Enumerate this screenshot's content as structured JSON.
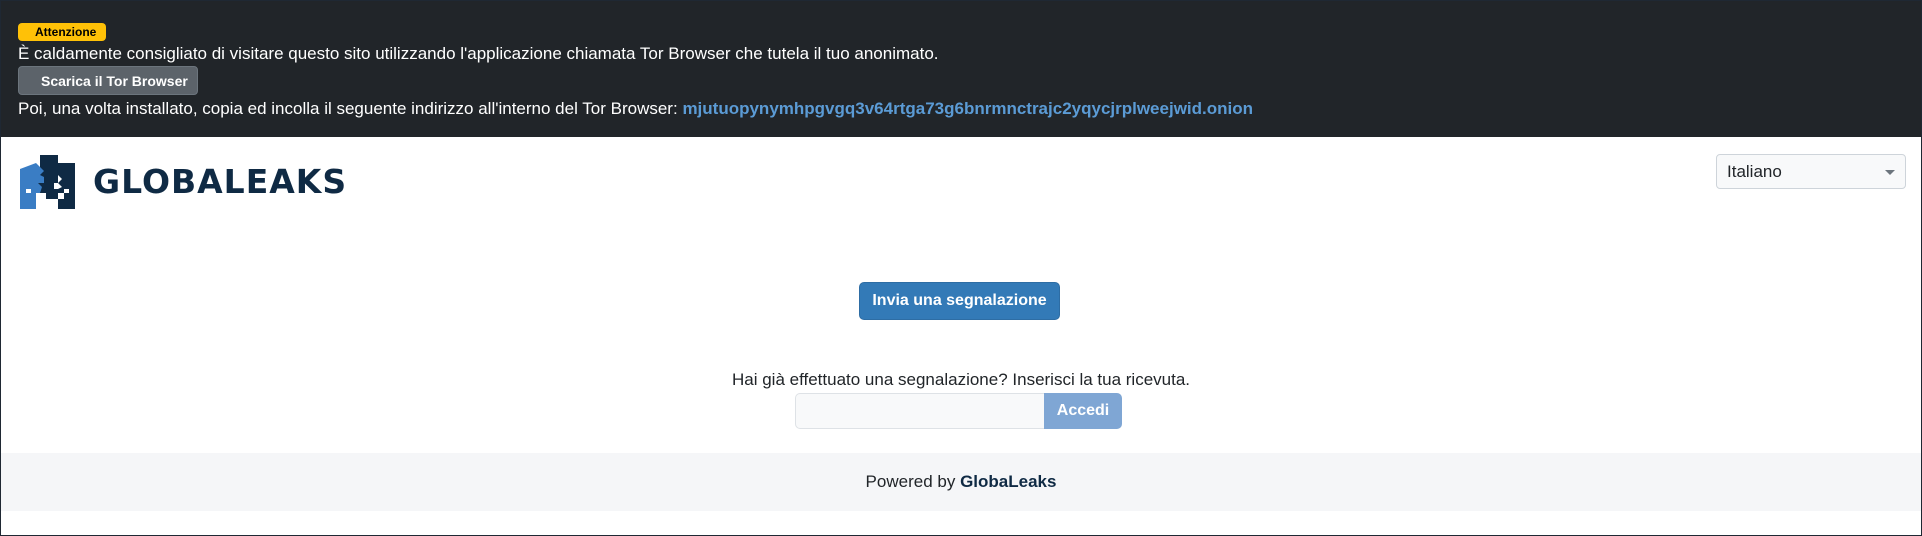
{
  "tor_banner": {
    "badge": "Attenzione",
    "message": "È caldamente consigliato di visitare questo sito utilizzando l'applicazione chiamata Tor Browser che tutela il tuo anonimato.",
    "download_button": "Scarica il Tor Browser",
    "instructions": "Poi, una volta installato, copia ed incolla il seguente indirizzo all'interno del Tor Browser:",
    "onion_address": "mjutuopynymhpgvgq3v64rtga73g6bnrmnctrajc2yqycjrplweejwid.onion"
  },
  "header": {
    "logo_icon": "globaleaks-heads-icon",
    "logo_text": "GLOBALEAKS",
    "language_selected": "Italiano"
  },
  "main": {
    "submit_button": "Invia una segnalazione",
    "receipt_prompt": "Hai già effettuato una segnalazione? Inserisci la tua ricevuta.",
    "receipt_placeholder": "",
    "login_button": "Accedi"
  },
  "footer": {
    "powered_by": "Powered by",
    "brand": "GlobaLeaks"
  },
  "colors": {
    "banner_bg": "#212529",
    "badge_warning": "#ffc107",
    "primary": "#337ab7",
    "primary_disabled": "#7fa6d4",
    "brand_dark": "#0f2a44",
    "onion_link": "#5b9bd5"
  }
}
